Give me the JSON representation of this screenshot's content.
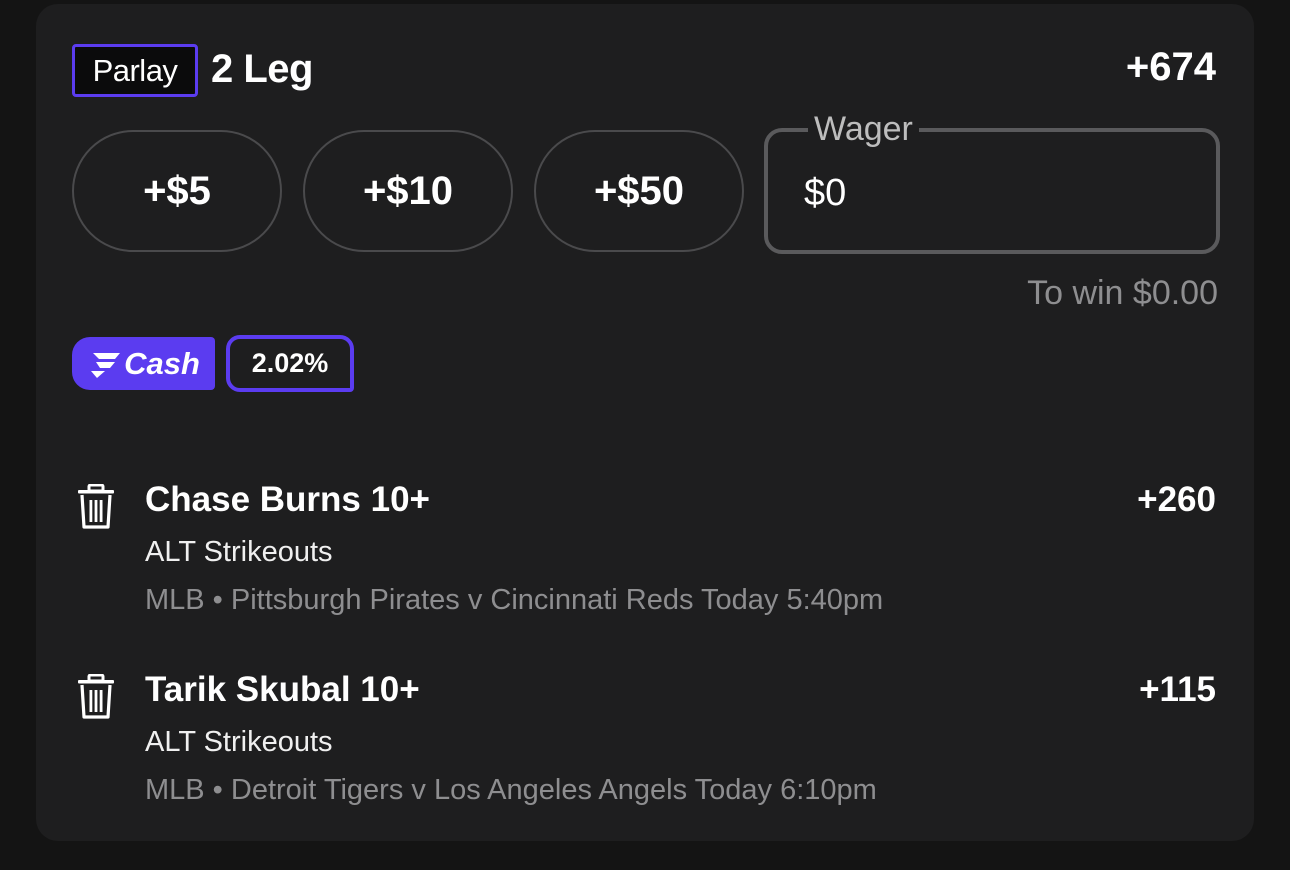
{
  "slip": {
    "bet_type": "Parlay",
    "leg_count_label": "2 Leg",
    "total_odds": "+674",
    "colors": {
      "accent": "#5b3cf0",
      "card_bg": "#1e1e1f",
      "page_bg": "#141414",
      "muted_text": "#8e8e90"
    }
  },
  "quick_wagers": [
    "+$5",
    "+$10",
    "+$50"
  ],
  "wager": {
    "label": "Wager",
    "value": "$0"
  },
  "to_win": "To win $0.00",
  "promo": {
    "fcash_label": "Cash",
    "fcash_icon": "fanduel-f-icon",
    "boost_pct": "2.02%"
  },
  "legs": [
    {
      "title": "Chase Burns 10+",
      "odds": "+260",
      "market": "ALT Strikeouts",
      "game": "MLB • Pittsburgh Pirates v Cincinnati Reds Today 5:40pm",
      "icon": "trash-icon"
    },
    {
      "title": "Tarik Skubal 10+",
      "odds": "+115",
      "market": "ALT Strikeouts",
      "game": "MLB • Detroit Tigers v Los Angeles Angels Today 6:10pm",
      "icon": "trash-icon"
    }
  ]
}
